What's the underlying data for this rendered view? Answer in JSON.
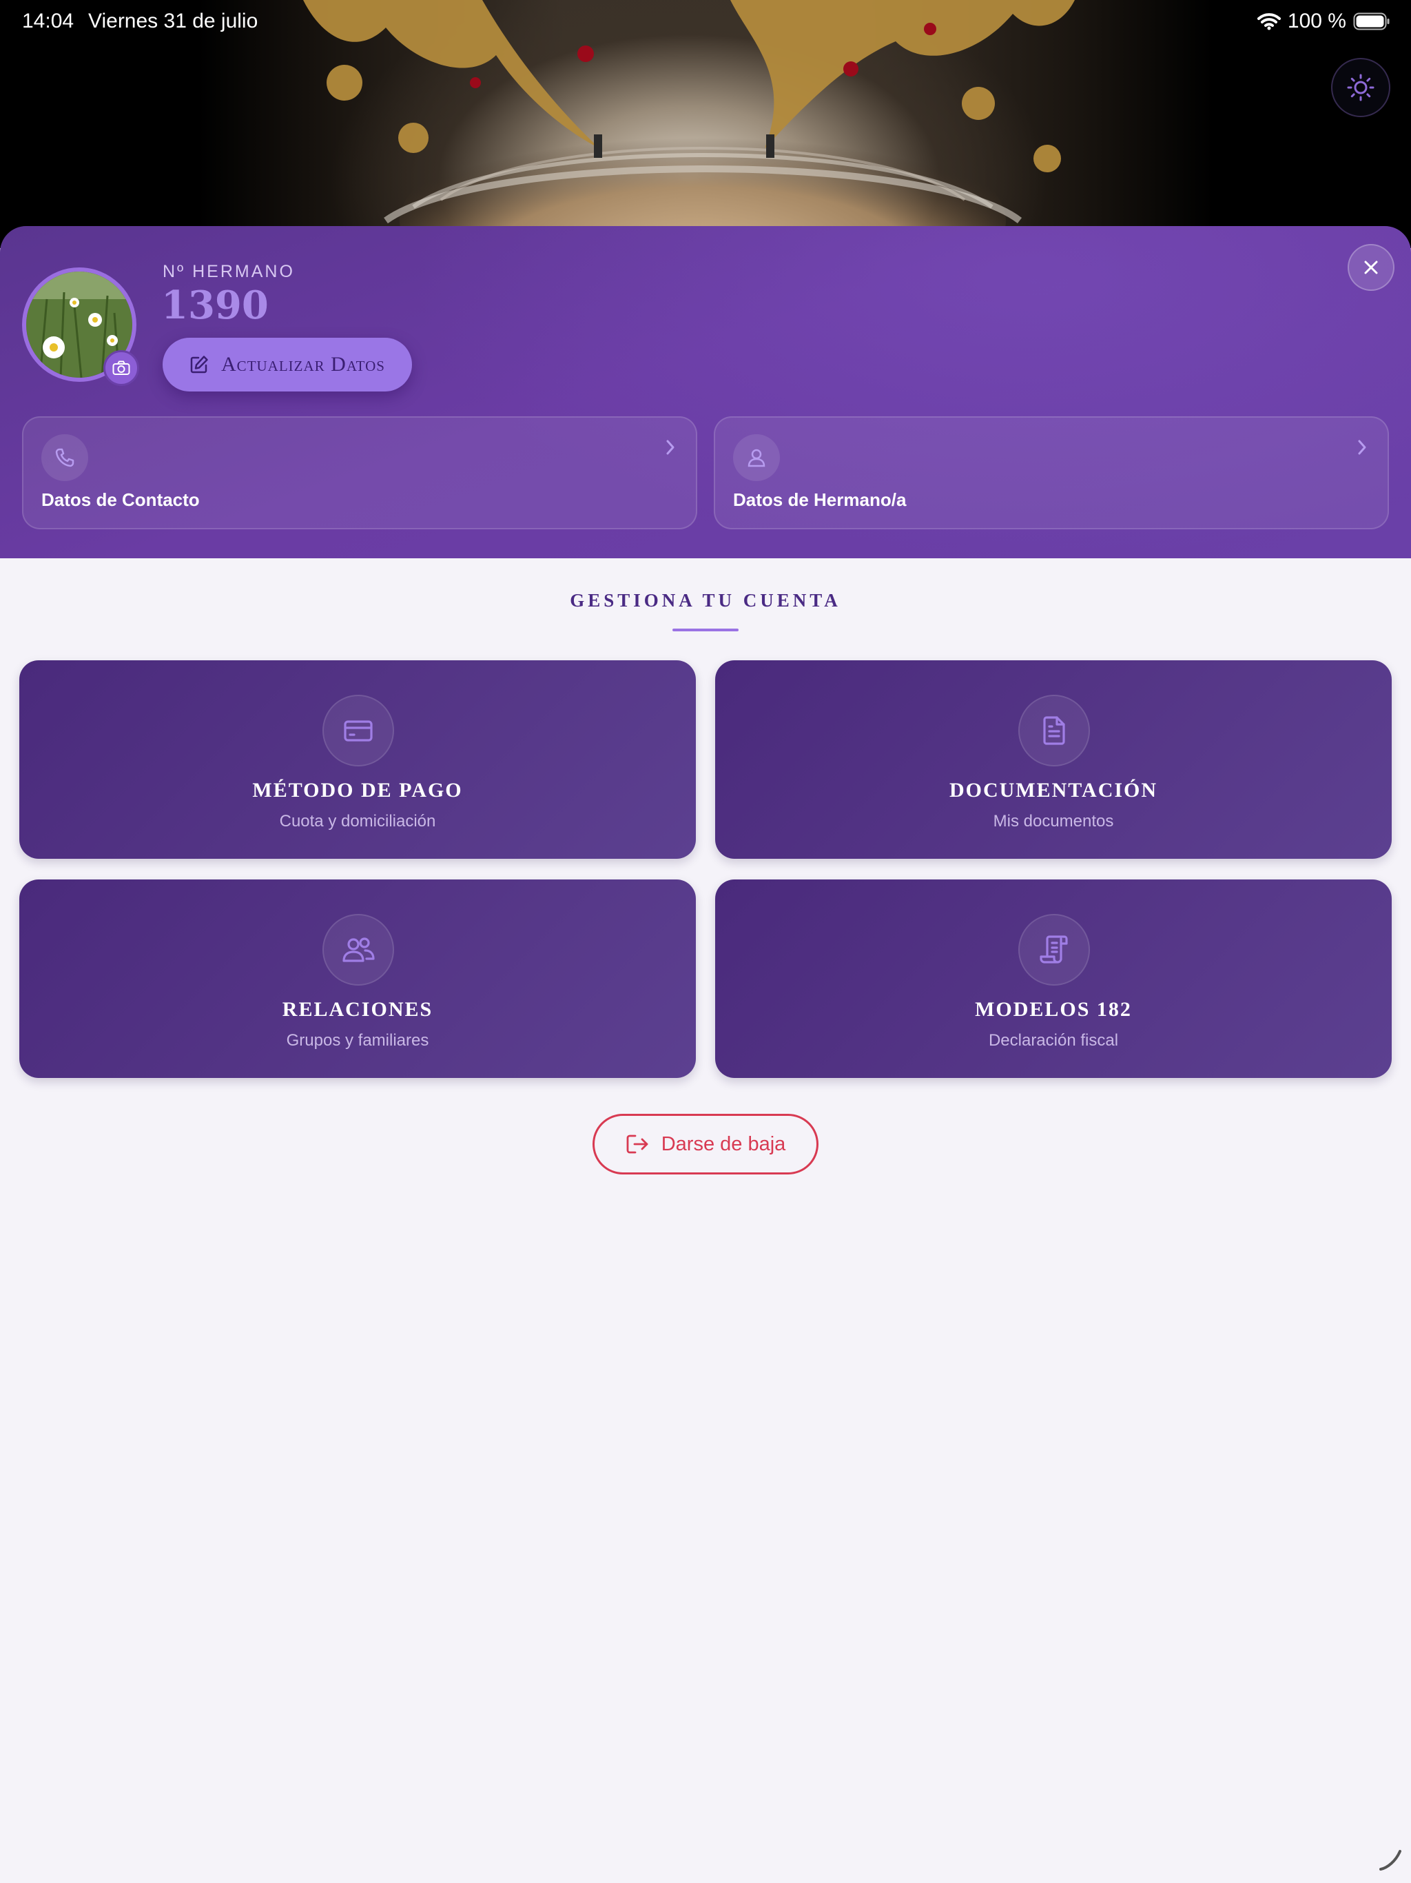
{
  "status_bar": {
    "time": "14:04",
    "date": "Viernes 31 de julio",
    "battery": "100 %"
  },
  "profile": {
    "member_label": "Nº HERMANO",
    "member_number": "1390",
    "update_button": "Actualizar Datos",
    "contact_card": {
      "label": "Datos de Contacto",
      "icon": "phone-icon"
    },
    "member_card": {
      "label": "Datos de Hermano/a",
      "icon": "user-icon"
    }
  },
  "section": {
    "title": "GESTIONA TU CUENTA"
  },
  "tiles": [
    {
      "title": "MÉTODO DE PAGO",
      "subtitle": "Cuota y domiciliación",
      "icon": "credit-card-icon"
    },
    {
      "title": "DOCUMENTACIÓN",
      "subtitle": "Mis documentos",
      "icon": "document-icon"
    },
    {
      "title": "RELACIONES",
      "subtitle": "Grupos y familiares",
      "icon": "users-icon"
    },
    {
      "title": "MODELOS 182",
      "subtitle": "Declaración fiscal",
      "icon": "scroll-icon"
    }
  ],
  "unsubscribe_button": "Darse de baja",
  "colors": {
    "accent": "#9a76e6",
    "header_purple": "#6a3ca4",
    "tile_purple": "#4a2a7c",
    "danger": "#d83a52",
    "background": "#f5f3f9"
  }
}
